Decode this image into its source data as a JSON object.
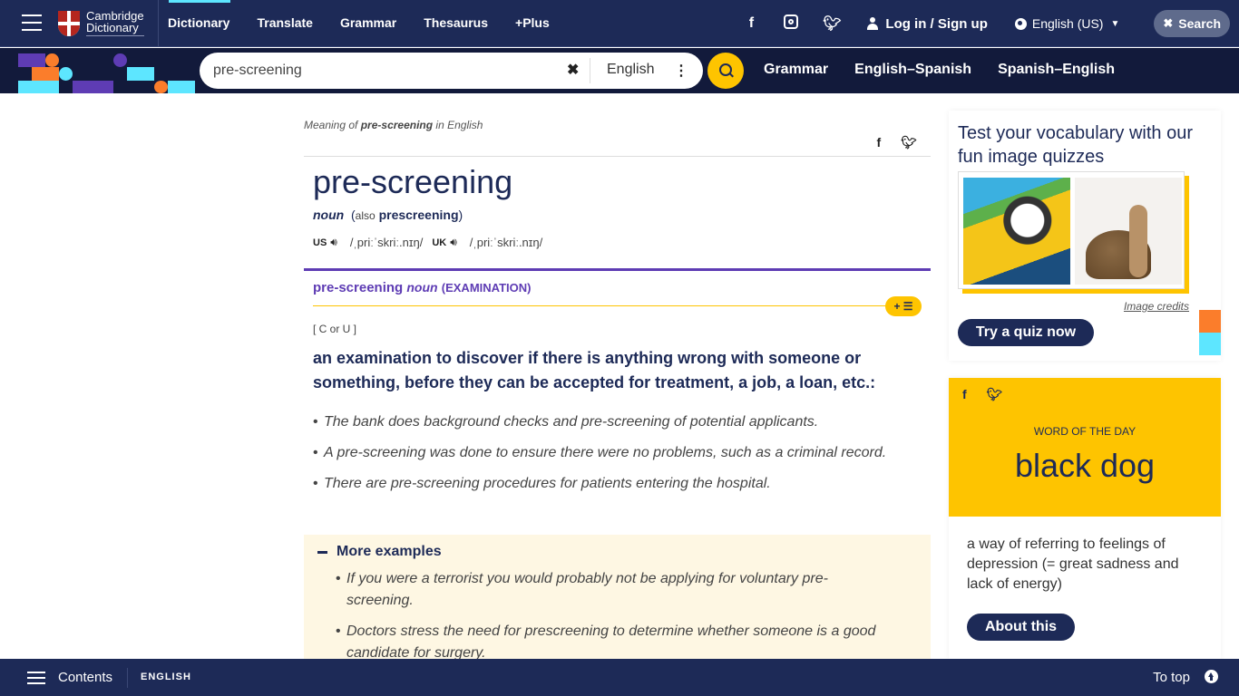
{
  "header": {
    "logo_line1": "Cambridge",
    "logo_line2": "Dictionary",
    "nav": [
      "Dictionary",
      "Translate",
      "Grammar",
      "Thesaurus",
      "+Plus"
    ],
    "social": [
      "facebook-icon",
      "instagram-icon",
      "twitter-icon"
    ],
    "login_label": "Log in / Sign up",
    "language_label": "English (US)",
    "search_toggle_label": "Search"
  },
  "search": {
    "query": "pre-screening",
    "dictionary": "English",
    "subnav": [
      "Grammar",
      "English–Spanish",
      "Spanish–English"
    ]
  },
  "entry": {
    "meaning_prefix": "Meaning of",
    "meaning_word": "pre-screening",
    "meaning_suffix": "in English",
    "headword": "pre-screening",
    "pos": "noun",
    "also_label": "also",
    "also_word": "prescreening",
    "us_label": "US",
    "us_ipa": "/ˌpriːˈskriː.nɪŋ/",
    "uk_label": "UK",
    "uk_ipa": "/ˌpriːˈskriː.nɪŋ/",
    "sense_word": "pre-screening",
    "sense_pos": "noun",
    "sense_guide": "(EXAMINATION)",
    "add_list_label": "+ ☰",
    "grammar": "[ C or U ]",
    "definition": "an examination to discover if there is anything wrong with someone or something, before they can be accepted for treatment, a job, a loan, etc.:",
    "examples": [
      "The bank does background checks and pre-screening of potential applicants.",
      "A pre-screening was done to ensure there were no problems, such as a criminal record.",
      "There are pre-screening procedures for patients entering the hospital."
    ],
    "more_examples_label": "More examples",
    "more_examples": [
      "If you were a terrorist you would probably not be applying for voluntary pre-screening.",
      "Doctors stress the need for prescreening to determine whether someone is a good candidate for surgery."
    ]
  },
  "quiz": {
    "title": "Test your vocabulary with our fun image quizzes",
    "credits_label": "Image credits",
    "button_label": "Try a quiz now"
  },
  "wotd": {
    "label": "WORD OF THE DAY",
    "word": "black dog",
    "definition": "a way of referring to feelings of depression (= great sadness and lack of energy)",
    "button_label": "About this"
  },
  "footer": {
    "contents_label": "Contents",
    "language_label": "ENGLISH",
    "to_top_label": "To top"
  }
}
